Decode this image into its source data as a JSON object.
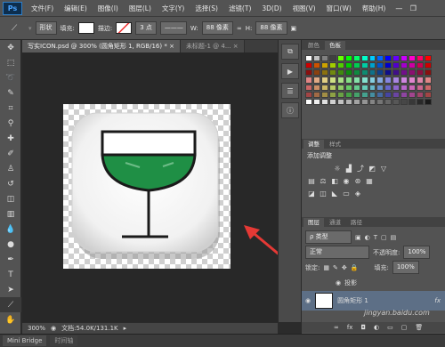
{
  "app": {
    "logo": "Ps"
  },
  "menu": [
    "文件(F)",
    "编辑(E)",
    "图像(I)",
    "图层(L)",
    "文字(Y)",
    "选择(S)",
    "滤镜(T)",
    "3D(D)",
    "视图(V)",
    "窗口(W)",
    "帮助(H)"
  ],
  "window_controls": {
    "minimize": "—",
    "restore": "❐",
    "close": "✕"
  },
  "options": {
    "mode": "形状",
    "fill_label": "填充:",
    "stroke_label": "描边:",
    "stroke_width": "3 点",
    "w_label": "W:",
    "w_value": "88 像素",
    "h_label": "H:",
    "h_value": "88 像素"
  },
  "tabs": [
    {
      "label": "写实ICON.psd @ 300% (圆角矩形 1, RGB/16) *",
      "close": "×"
    },
    {
      "label": "未标题-1 @ 4...",
      "close": "×"
    }
  ],
  "status": {
    "zoom": "300%",
    "doc_info": "文档:54.0K/131.1K"
  },
  "bottom_tabs": [
    "Mini Bridge",
    "时间轴"
  ],
  "panels": {
    "swatches_tabs": [
      "颜色",
      "色板"
    ],
    "adjust_tabs": [
      "调整",
      "样式"
    ],
    "adjust_title": "添加调整",
    "layers_tabs": [
      "图层",
      "通道",
      "路径"
    ],
    "kind_label": "ρ 类型",
    "blend_mode": "正常",
    "opacity_label": "不透明度:",
    "opacity_value": "100%",
    "lock_label": "锁定:",
    "fill_label": "填充:",
    "fill_value": "100%",
    "effect_name": "投影",
    "layer_name": "圆角矩形 1",
    "fx": "fx"
  },
  "watermark": "jingyan.baidu.com",
  "colors": {
    "accent_arrow": "#e53935",
    "glass_liquid": "#1f8f45",
    "glass_outline": "#1a1a1a",
    "ui_dark": "#535353"
  }
}
